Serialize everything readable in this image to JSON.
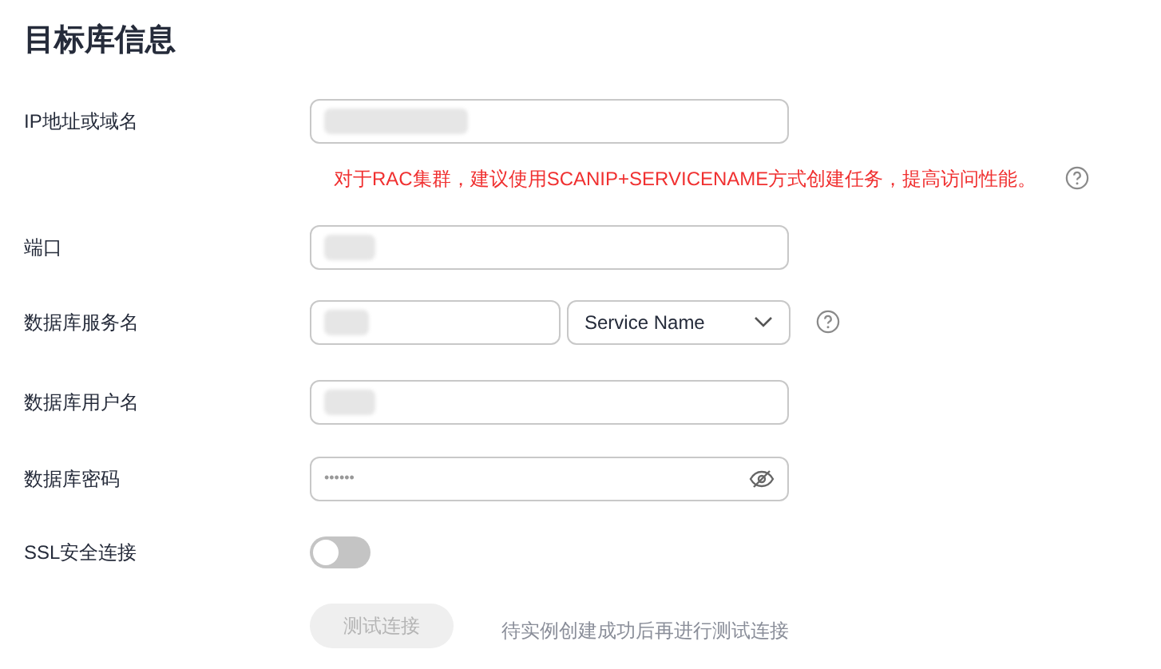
{
  "title": "目标库信息",
  "fields": [
    {
      "label": "IP地址或域名",
      "kind": "text",
      "hint": "对于RAC集群，建议使用SCANIP+SERVICENAME方式创建任务，提高访问性能。"
    },
    {
      "label": "端口",
      "kind": "text"
    },
    {
      "label": "数据库服务名",
      "kind": "service",
      "select": {
        "value": "Service Name"
      }
    },
    {
      "label": "数据库用户名",
      "kind": "text"
    },
    {
      "label": "数据库密码",
      "kind": "password",
      "value": "••••••"
    },
    {
      "label": "SSL安全连接",
      "kind": "toggle",
      "on": false
    }
  ],
  "test_button": {
    "label": "测试连接",
    "disabled": true
  },
  "test_note": "待实例创建成功后再进行测试连接"
}
